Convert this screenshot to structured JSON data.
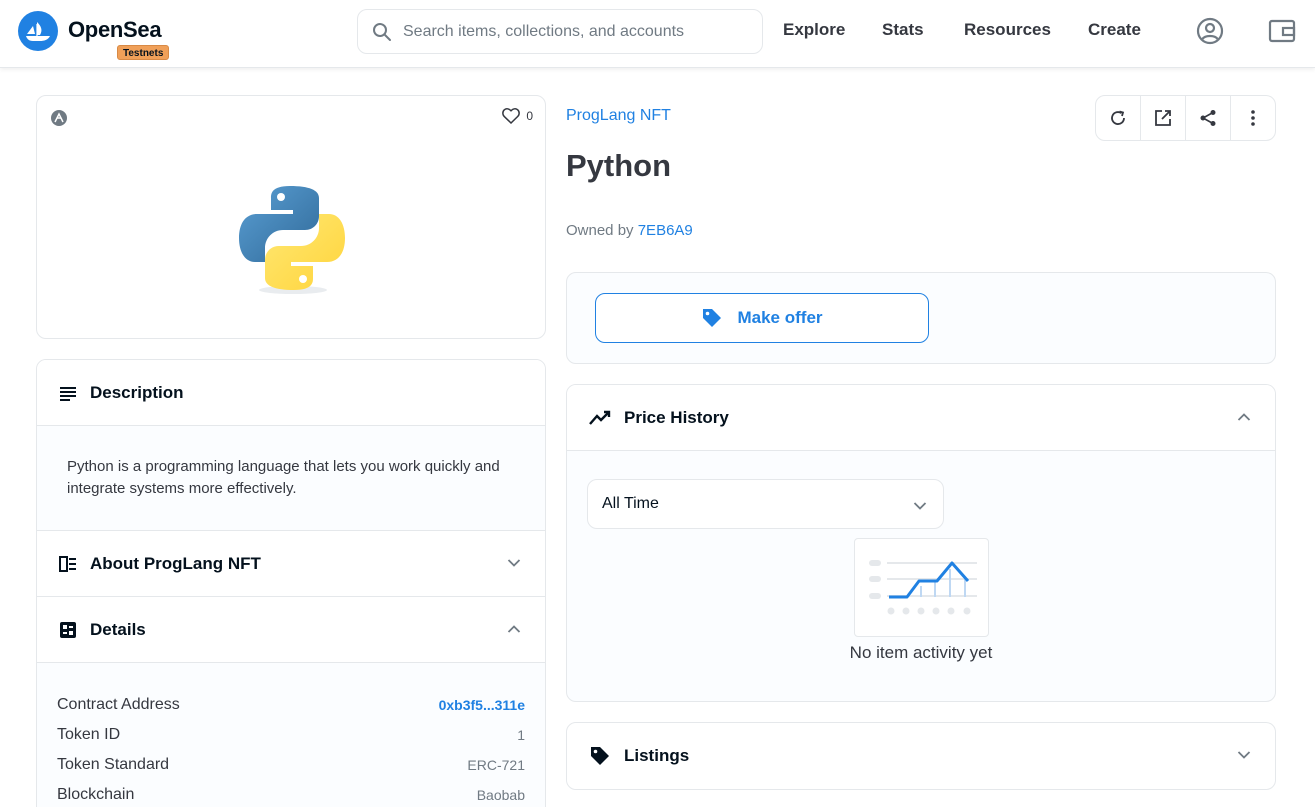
{
  "header": {
    "brand": "OpenSea",
    "badge": "Testnets",
    "search_placeholder": "Search items, collections, and accounts",
    "nav": [
      "Explore",
      "Stats",
      "Resources",
      "Create"
    ]
  },
  "item": {
    "like_count": "0",
    "collection": "ProgLang NFT",
    "title": "Python",
    "owned_prefix": "Owned by",
    "owner": "7EB6A9"
  },
  "description": {
    "title": "Description",
    "text": "Python is a programming language that lets you work quickly and integrate systems more effectively."
  },
  "about": {
    "title": "About ProgLang NFT"
  },
  "details": {
    "title": "Details",
    "rows": [
      {
        "k": "Contract Address",
        "v": "0xb3f5...311e"
      },
      {
        "k": "Token ID",
        "v": "1"
      },
      {
        "k": "Token Standard",
        "v": "ERC-721"
      },
      {
        "k": "Blockchain",
        "v": "Baobab"
      }
    ]
  },
  "offer": {
    "label": "Make offer"
  },
  "price_history": {
    "title": "Price History",
    "range": "All Time",
    "empty": "No item activity yet"
  },
  "listings": {
    "title": "Listings"
  },
  "colors": {
    "accent": "#2081e2",
    "badge": "#f0a059"
  }
}
